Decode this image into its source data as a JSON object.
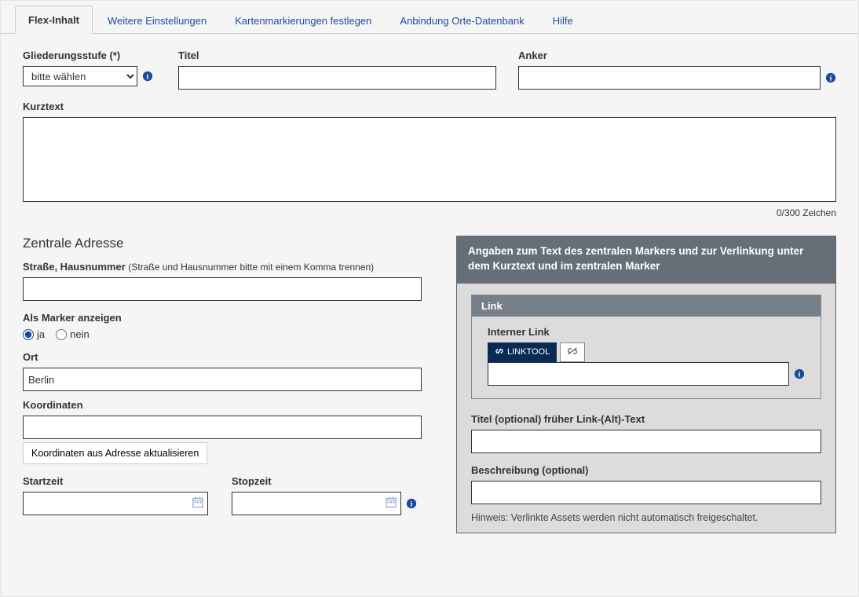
{
  "tabs": {
    "flex": "Flex-Inhalt",
    "weitere": "Weitere Einstellungen",
    "karten": "Kartenmarkierungen festlegen",
    "anbindung": "Anbindung Orte-Datenbank",
    "hilfe": "Hilfe"
  },
  "fields": {
    "gliederung_label": "Gliederungsstufe (*)",
    "gliederung_option": "bitte wählen",
    "titel_label": "Titel",
    "titel_value": "",
    "anker_label": "Anker",
    "anker_value": "",
    "kurztext_label": "Kurztext",
    "kurztext_value": "",
    "char_count": "0/300 Zeichen"
  },
  "address": {
    "section_title": "Zentrale Adresse",
    "street_label": "Straße, Hausnummer",
    "street_hint": "(Straße und Hausnummer bitte mit einem Komma trennen)",
    "street_value": "",
    "marker_label": "Als Marker anzeigen",
    "marker_yes": "ja",
    "marker_no": "nein",
    "ort_label": "Ort",
    "ort_value": "Berlin",
    "koord_label": "Koordinaten",
    "koord_value": "",
    "update_btn": "Koordinaten aus Adresse aktualisieren",
    "start_label": "Startzeit",
    "start_value": "",
    "stop_label": "Stopzeit",
    "stop_value": ""
  },
  "marker_panel": {
    "head": "Angaben zum Text des zentralen Markers und zur Verlinkung unter dem Kurztext und im zentralen Marker",
    "link_head": "Link",
    "intern_label": "Interner Link",
    "linktool_btn": "LINKTOOL",
    "intern_value": "",
    "titel_opt_label": "Titel (optional) früher Link-(Alt)-Text",
    "titel_opt_value": "",
    "beschreibung_label": "Beschreibung (optional)",
    "beschreibung_value": "",
    "hint": "Hinweis: Verlinkte Assets werden nicht automatisch freigeschaltet."
  }
}
